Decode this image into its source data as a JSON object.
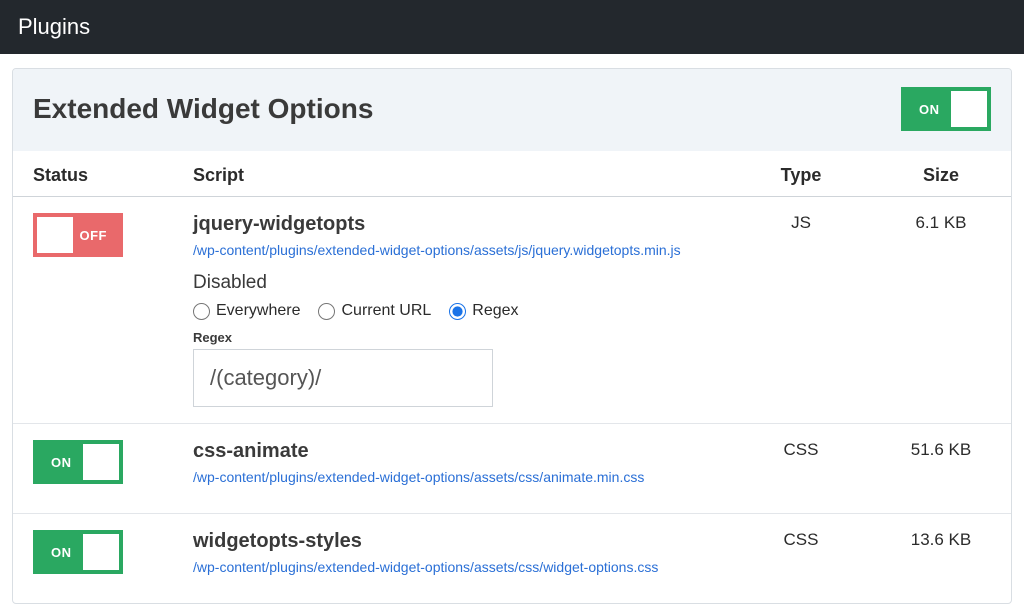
{
  "header": {
    "title": "Plugins"
  },
  "plugin": {
    "title": "Extended Widget Options",
    "master_toggle": {
      "state": "ON"
    }
  },
  "table": {
    "headers": {
      "status": "Status",
      "script": "Script",
      "type": "Type",
      "size": "Size"
    }
  },
  "toggle_labels": {
    "on": "ON",
    "off": "OFF"
  },
  "disabled_ui": {
    "heading": "Disabled",
    "options": {
      "everywhere": "Everywhere",
      "current_url": "Current URL",
      "regex": "Regex"
    },
    "regex_label": "Regex"
  },
  "rows": [
    {
      "status": "OFF",
      "name": "jquery-widgetopts",
      "path": "/wp-content/plugins/extended-widget-options/assets/js/jquery.widgetopts.min.js",
      "type": "JS",
      "size": "6.1 KB",
      "disabled_selected": "regex",
      "regex_value": "/(category)/"
    },
    {
      "status": "ON",
      "name": "css-animate",
      "path": "/wp-content/plugins/extended-widget-options/assets/css/animate.min.css",
      "type": "CSS",
      "size": "51.6 KB"
    },
    {
      "status": "ON",
      "name": "widgetopts-styles",
      "path": "/wp-content/plugins/extended-widget-options/assets/css/widget-options.css",
      "type": "CSS",
      "size": "13.6 KB"
    }
  ]
}
